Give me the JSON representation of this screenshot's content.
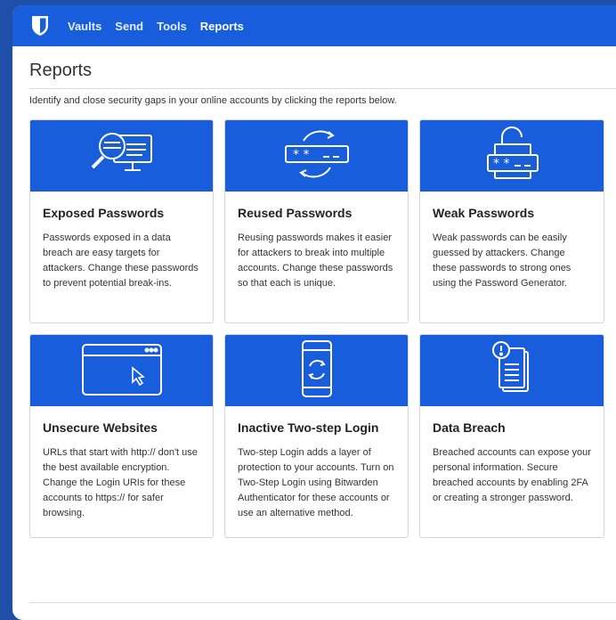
{
  "nav": {
    "logo_icon": "bitwarden-shield-icon",
    "items": [
      {
        "label": "Vaults"
      },
      {
        "label": "Send"
      },
      {
        "label": "Tools"
      },
      {
        "label": "Reports"
      }
    ],
    "active": "Reports"
  },
  "page": {
    "title": "Reports",
    "subtitle": "Identify and close security gaps in your online accounts by clicking the reports below."
  },
  "cards": [
    {
      "icon": "magnifier-monitor-icon",
      "title": "Exposed Passwords",
      "text": "Passwords exposed in a data breach are easy targets for attackers. Change these passwords to prevent potential break-ins."
    },
    {
      "icon": "reused-password-icon",
      "title": "Reused Passwords",
      "text": "Reusing passwords makes it easier for attackers to break into multiple accounts. Change these passwords so that each is unique."
    },
    {
      "icon": "weak-password-lock-icon",
      "title": "Weak Passwords",
      "text": "Weak passwords can be easily guessed by attackers. Change these passwords to strong ones using the Password Generator."
    },
    {
      "icon": "browser-window-icon",
      "title": "Unsecure Websites",
      "text": "URLs that start with http:// don't use the best available encryption. Change the Login URIs for these accounts to https:// for safer browsing."
    },
    {
      "icon": "phone-sync-icon",
      "title": "Inactive Two-step Login",
      "text": "Two-step Login adds a layer of protection to your accounts. Turn on Two-Step Login using Bitwarden Authenticator for these accounts or use an alternative method."
    },
    {
      "icon": "document-alert-icon",
      "title": "Data Breach",
      "text": "Breached accounts can expose your personal information. Secure breached accounts by enabling 2FA or creating a stronger password."
    }
  ],
  "colors": {
    "brand_blue": "#175ddc",
    "outer_background": "#1f4fa8"
  }
}
